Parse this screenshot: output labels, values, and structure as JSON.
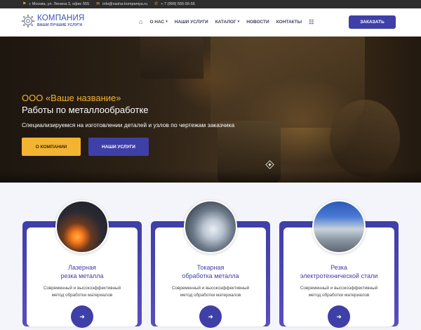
{
  "topbar": {
    "address": "г. Москва, ул. Ленина 3, офис 555",
    "email": "info@vasha-kompaniya.ru",
    "phone": "+ 7 (999) 555-55-55"
  },
  "logo": {
    "title": "КОМПАНИЯ",
    "subtitle": "ВАШИ ЛУЧШИЕ УСЛУГИ"
  },
  "nav": {
    "items": [
      {
        "label": "О НАС"
      },
      {
        "label": "НАШИ УСЛУГИ"
      },
      {
        "label": "КАТАЛОГ"
      },
      {
        "label": "НОВОСТИ"
      },
      {
        "label": "КОНТАКТЫ"
      }
    ],
    "order_button": "ЗАКАЗАТЬ"
  },
  "hero": {
    "company": "ООО «Ваше название»",
    "headline": "Работы по металлообработке",
    "description": "Специализируемся на изготовлении деталей и узлов по чертежам заказчика",
    "btn_about": "О КОМПАНИИ",
    "btn_services": "НАШИ УСЛУГИ"
  },
  "services": [
    {
      "title_line1": "Лазерная",
      "title_line2": "резка металла",
      "desc_line1": "Современный и высокоэффективный",
      "desc_line2": "метод обработки материалов"
    },
    {
      "title_line1": "Токарная",
      "title_line2": "обработка металла",
      "desc_line1": "Современный и высокоэффективный",
      "desc_line2": "метод обработки материалов"
    },
    {
      "title_line1": "Резка",
      "title_line2": "электротехнической стали",
      "desc_line1": "Современный и высокоэффективный",
      "desc_line2": "метод обработки материалов"
    }
  ],
  "colors": {
    "accent": "#3f3fa8",
    "highlight": "#f3b431",
    "topbar": "#2d2d2d"
  },
  "icons": {
    "address": "map-icon",
    "email": "mail-icon",
    "phone": "phone-icon",
    "home": "home-icon",
    "sitemap": "sitemap-icon",
    "card_arrow": "arrow-right-icon"
  }
}
